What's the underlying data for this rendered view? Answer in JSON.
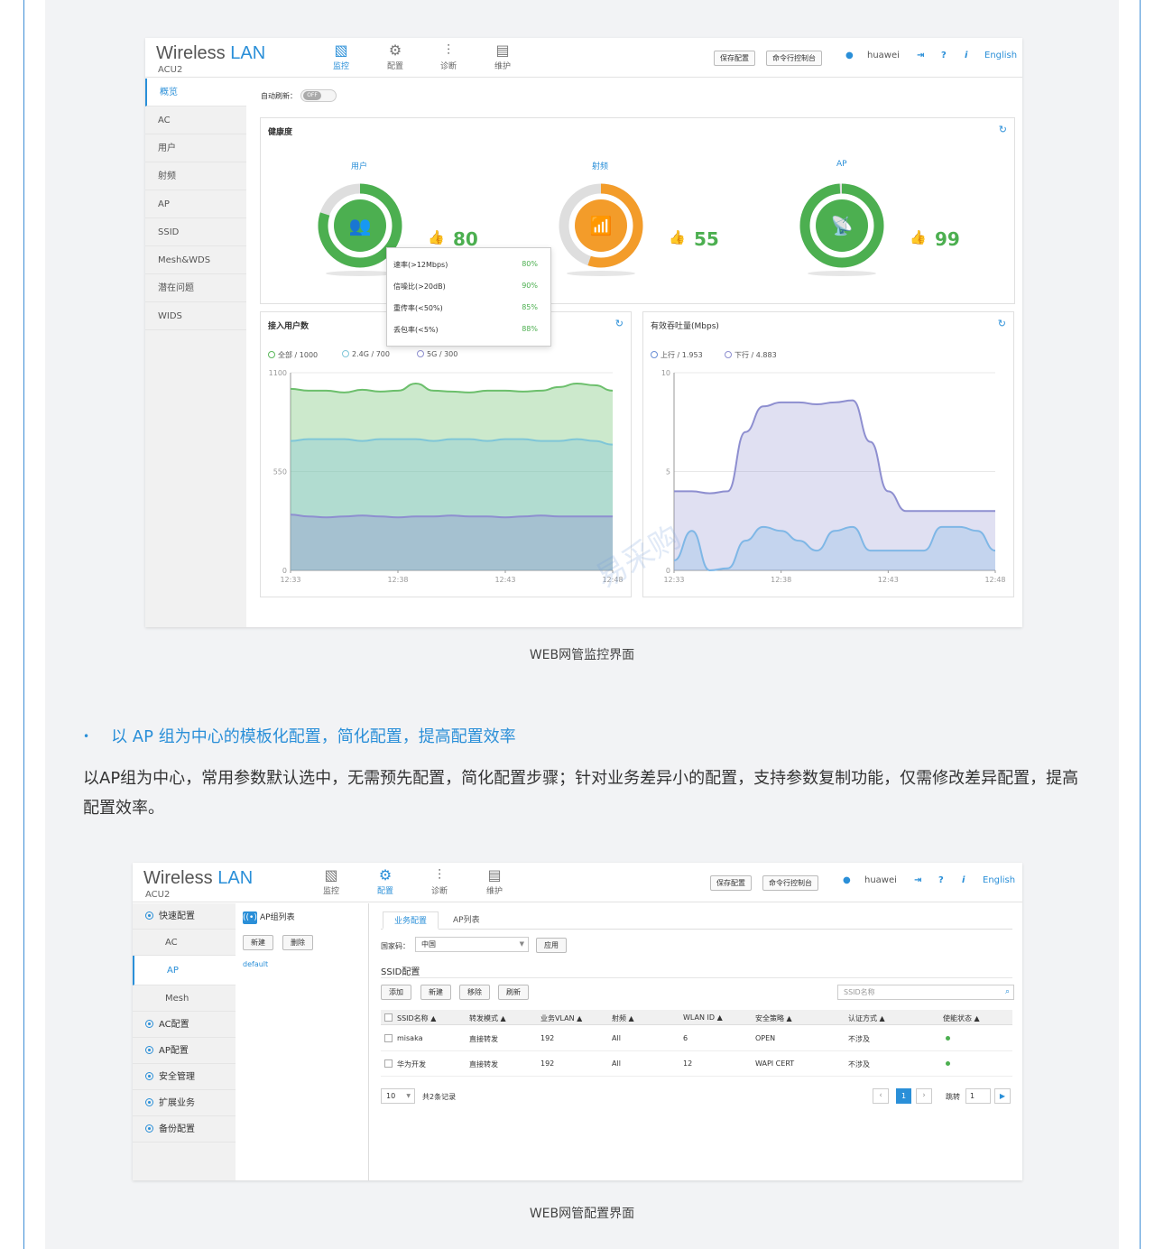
{
  "app": {
    "name_main": "Wireless ",
    "name_accent": "LAN",
    "subtitle": "ACU2"
  },
  "nav": [
    {
      "label": "监控",
      "icon": "monitor-icon"
    },
    {
      "label": "配置",
      "icon": "gear-icon"
    },
    {
      "label": "诊断",
      "icon": "sliders-icon"
    },
    {
      "label": "维护",
      "icon": "maintenance-icon"
    }
  ],
  "toolbar": {
    "save": "保存配置",
    "cli": "命令行控制台",
    "user": "huawei",
    "help": "?",
    "info": "i",
    "lang": "English"
  },
  "screen1": {
    "sidebar": [
      "概览",
      "AC",
      "用户",
      "射频",
      "AP",
      "SSID",
      "Mesh&WDS",
      "潜在问题",
      "WIDS"
    ],
    "auto_refresh_label": "自动刷新：",
    "auto_refresh_state": "OFF",
    "health": {
      "title": "健康度",
      "gauges": [
        {
          "label": "用户",
          "score": 80,
          "percent": 80,
          "color": "#4caf50"
        },
        {
          "label": "射频",
          "score": 55,
          "percent": 55,
          "color": "#f39c2a"
        },
        {
          "label": "AP",
          "score": 99,
          "percent": 99,
          "color": "#4caf50"
        }
      ]
    },
    "tooltip": [
      {
        "name": "速率(>12Mbps)",
        "value": "80%"
      },
      {
        "name": "信噪比(>20dB)",
        "value": "90%"
      },
      {
        "name": "重传率(<50%)",
        "value": "85%"
      },
      {
        "name": "丢包率(<5%)",
        "value": "88%"
      }
    ],
    "users_panel": {
      "title": "接入用户数",
      "legend": [
        "全部 / 1000",
        "2.4G / 700",
        "5G / 300"
      ]
    },
    "throughput_panel": {
      "title": "有效吞吐量(Mbps)",
      "legend": [
        "上行 / 1.953",
        "下行 / 4.883"
      ]
    },
    "caption": "WEB网管监控界面"
  },
  "chart_data": [
    {
      "type": "area",
      "title": "接入用户数",
      "x": [
        "12:33",
        "12:38",
        "12:43",
        "12:48"
      ],
      "ylim": [
        0,
        1100
      ],
      "yticks": [
        "1100",
        "550",
        "0"
      ],
      "series": [
        {
          "name": "全部",
          "color": "#6cbf6c",
          "values": [
            1010,
            1000,
            1000,
            990,
            1005,
            995,
            1000,
            1040,
            1000,
            995,
            990,
            1000,
            1000,
            995,
            1000,
            1020,
            1040,
            1030,
            1000
          ]
        },
        {
          "name": "2.4G",
          "color": "#7fc6d8",
          "values": [
            720,
            730,
            730,
            730,
            720,
            730,
            730,
            730,
            720,
            730,
            730,
            720,
            730,
            730,
            720,
            720,
            730,
            720,
            700
          ]
        },
        {
          "name": "5G",
          "color": "#8e8fd0",
          "values": [
            310,
            300,
            295,
            300,
            305,
            300,
            295,
            300,
            300,
            305,
            300,
            300,
            295,
            300,
            305,
            300,
            300,
            300,
            300
          ]
        }
      ]
    },
    {
      "type": "area",
      "title": "有效吞吐量(Mbps)",
      "x": [
        "12:33",
        "12:38",
        "12:43",
        "12:48"
      ],
      "ylim": [
        0,
        10
      ],
      "yticks": [
        "10",
        "5",
        "0"
      ],
      "series": [
        {
          "name": "上行",
          "color": "#8e8fd0",
          "values": [
            4.0,
            4.0,
            3.9,
            4.0,
            7.0,
            8.3,
            8.5,
            8.5,
            8.4,
            8.5,
            8.6,
            6.5,
            4.0,
            3.0,
            3.0,
            3.0,
            3.0,
            3.0,
            3.0
          ]
        },
        {
          "name": "下行",
          "color": "#7fb7e6",
          "values": [
            0.5,
            2.0,
            0.0,
            0.1,
            1.5,
            2.2,
            2.0,
            1.5,
            1.0,
            2.0,
            2.2,
            1.0,
            1.0,
            1.0,
            1.0,
            2.2,
            2.2,
            2.0,
            1.0
          ]
        }
      ]
    }
  ],
  "section": {
    "bullet": "以 AP 组为中心的模板化配置，简化配置，提高配置效率",
    "paragraph": "以AP组为中心，常用参数默认选中，无需预先配置，简化配置步骤；针对业务差异小的配置，支持参数复制功能，仅需修改差异配置，提高配置效率。"
  },
  "screen2": {
    "sidebar": [
      {
        "label": "快速配置",
        "type": "group"
      },
      {
        "label": "AC",
        "type": "sub"
      },
      {
        "label": "AP",
        "type": "sub",
        "active": true
      },
      {
        "label": "Mesh",
        "type": "sub"
      },
      {
        "label": "AC配置",
        "type": "group"
      },
      {
        "label": "AP配置",
        "type": "group"
      },
      {
        "label": "安全管理",
        "type": "group"
      },
      {
        "label": "扩展业务",
        "type": "group"
      },
      {
        "label": "备份配置",
        "type": "group"
      }
    ],
    "ap_group": {
      "title": "AP组列表",
      "new": "新建",
      "delete": "删除",
      "item": "default"
    },
    "tabs": [
      "业务配置",
      "AP列表"
    ],
    "country_label": "国家码：",
    "country_value": "中国",
    "apply": "应用",
    "ssid_title": "SSID配置",
    "ssid_buttons": [
      "添加",
      "新建",
      "移除",
      "刷新"
    ],
    "ssid_search_placeholder": "SSID名称",
    "columns": [
      "SSID名称 ▲",
      "转发模式 ▲",
      "业务VLAN ▲",
      "射频 ▲",
      "WLAN ID ▲",
      "安全策略 ▲",
      "认证方式 ▲",
      "使能状态 ▲"
    ],
    "rows": [
      [
        "misaka",
        "直接转发",
        "192",
        "All",
        "6",
        "OPEN",
        "不涉及"
      ],
      [
        "华为开发",
        "直接转发",
        "192",
        "All",
        "12",
        "WAPI CERT",
        "不涉及"
      ]
    ],
    "page_size": "10",
    "total": "共2条记录",
    "current_page": "1",
    "jump_label": "跳转",
    "jump_value": "1",
    "caption": "WEB网管配置界面"
  },
  "watermark": "易采购"
}
